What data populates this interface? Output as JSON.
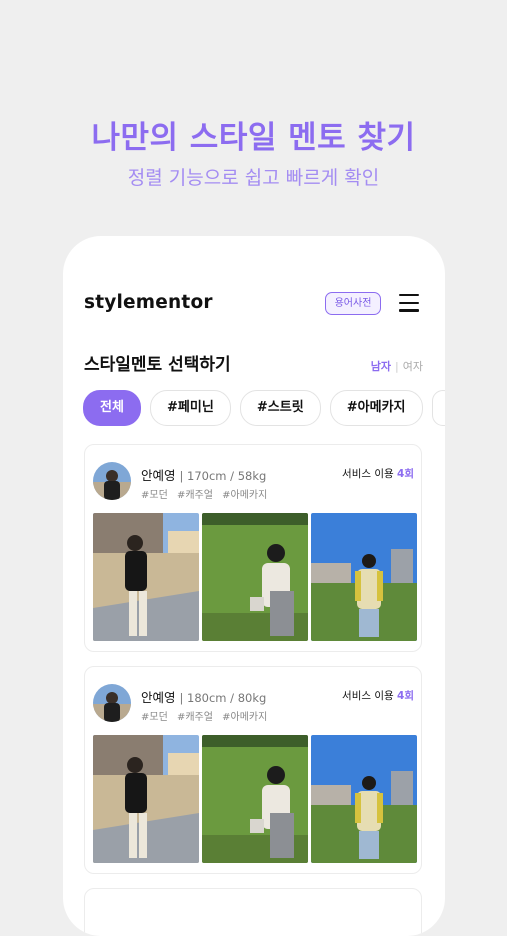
{
  "promo": {
    "headline": "나만의 스타일 멘토 찾기",
    "subline": "정렬 기능으로 쉽고 빠르게 확인"
  },
  "app": {
    "logo": "stylementor",
    "dict_button": "용어사전",
    "menu_icon": "hamburger-menu-icon"
  },
  "section": {
    "title": "스타일멘토 선택하기",
    "gender_male": "남자",
    "gender_separator": "|",
    "gender_female": "여자"
  },
  "chips": [
    "전체",
    "#페미닌",
    "#스트릿",
    "#아메카지"
  ],
  "mentors": [
    {
      "name": "안예영",
      "stats": "| 170cm / 58kg",
      "tags": [
        "#모던",
        "#캐주얼",
        "#아메카지"
      ],
      "service_label": "서비스 이용",
      "service_count": "4회"
    },
    {
      "name": "안예영",
      "stats": "| 180cm / 80kg",
      "tags": [
        "#모던",
        "#캐주얼",
        "#아메카지"
      ],
      "service_label": "서비스 이용",
      "service_count": "4회"
    }
  ],
  "colors": {
    "accent": "#8c6cf0",
    "background": "#efefef",
    "card_border": "#ececec"
  }
}
